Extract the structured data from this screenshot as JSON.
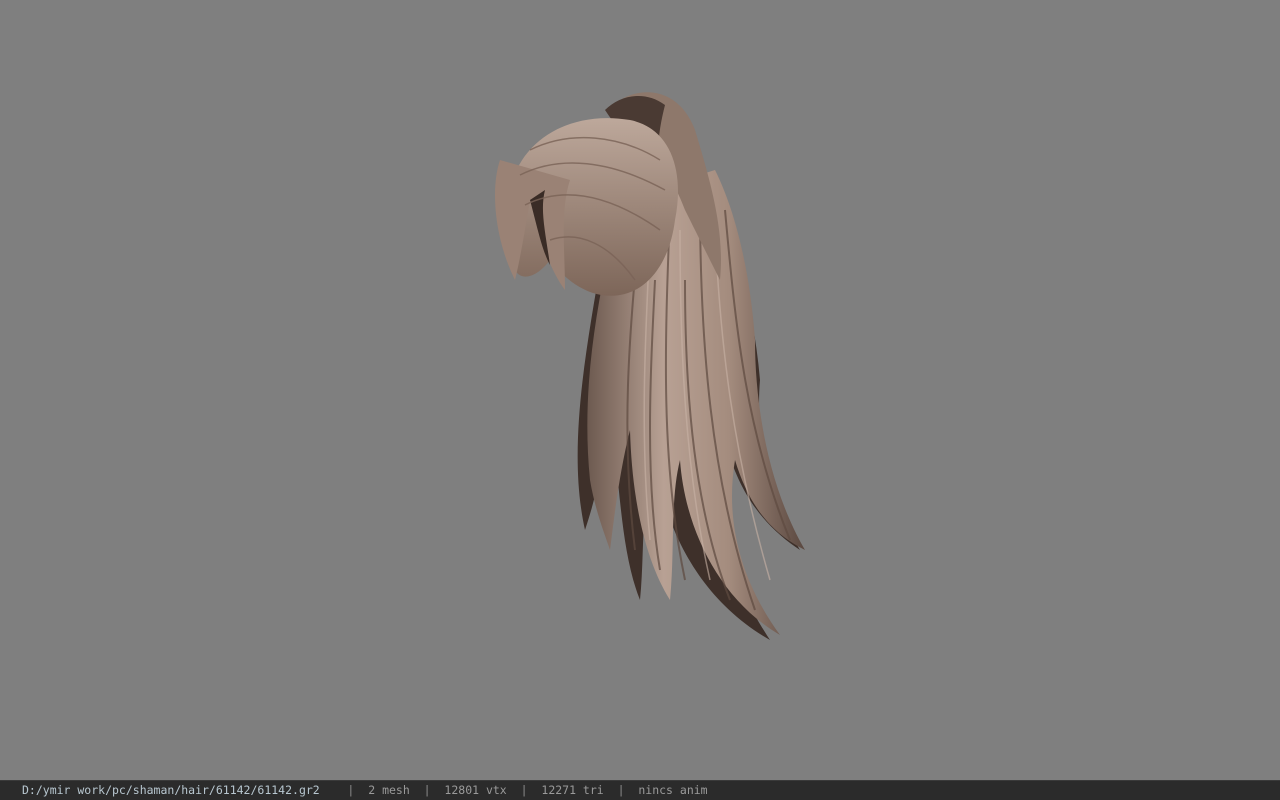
{
  "viewport": {
    "background_color": "#7f7f7f",
    "model": {
      "subject": "hair model",
      "hair_color_light": "#b49c8e",
      "hair_color_mid": "#8c7466",
      "hair_color_dark": "#3a2c26"
    }
  },
  "statusbar": {
    "file_path": "D:/ymir work/pc/shaman/hair/61142/61142.gr2",
    "separator": "|",
    "mesh_count": "2 mesh",
    "vertex_count": "12801 vtx",
    "triangle_count": "12271 tri",
    "anim_status": "nincs anim"
  }
}
